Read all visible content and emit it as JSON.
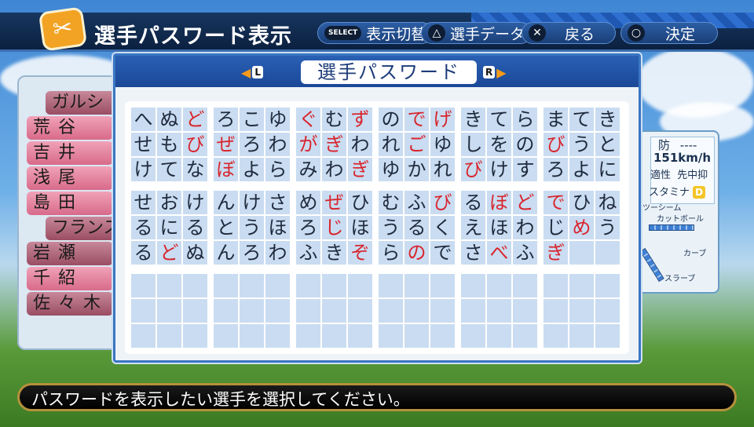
{
  "header": {
    "title": "選手パスワード表示",
    "hints": [
      {
        "glyph": "SELECT",
        "label": "表示切替"
      },
      {
        "glyph": "△",
        "label": "選手データ"
      },
      {
        "glyph": "✕",
        "label": "戻る"
      },
      {
        "glyph": "○",
        "label": "決定"
      }
    ]
  },
  "roster": [
    "ガルシ",
    "荒谷",
    "吉井",
    "浅尾",
    "島田",
    "フランス",
    "岩瀬",
    "千紹",
    "佐々木"
  ],
  "player_card": {
    "position_label": "防",
    "position_value": "----",
    "speed": "151km/h",
    "aptitude_label": "適性",
    "aptitude_value": "先中抑",
    "stamina_label": "スタミナ",
    "stamina_rank": "D",
    "pitches": [
      "ツーシーム",
      "カットボール",
      "カーブ",
      "スラーブ"
    ]
  },
  "dialog": {
    "title": "選手パスワード",
    "left_key": "L",
    "right_key": "R",
    "rows": [
      "へぬどろこゆぐむずのでげきてらまてき",
      "せもびぜろわがぎわれごゆしをのびうと",
      "けてなぼよらみわぎゆかれびけすろよに",
      "せおけんけさめぜひむふびるぼどでひね",
      "るにるとうほろじほうるくえほわじめう",
      "るどぬんろわふきぞらのでさべふぎ"
    ],
    "red_marks": [
      [
        2,
        6,
        8,
        10,
        11
      ],
      [
        2,
        3,
        6,
        7,
        10,
        15
      ],
      [
        3,
        8,
        12
      ],
      [
        7,
        11,
        13,
        14,
        15
      ],
      [
        7,
        16
      ],
      [
        1,
        8,
        10,
        13,
        15
      ]
    ]
  },
  "message": "パスワードを表示したい選手を選択してください。",
  "colors": {
    "cell_bg": "#c9dcf1",
    "red_char": "#d8252d",
    "dialog_border": "#3a76c2"
  }
}
